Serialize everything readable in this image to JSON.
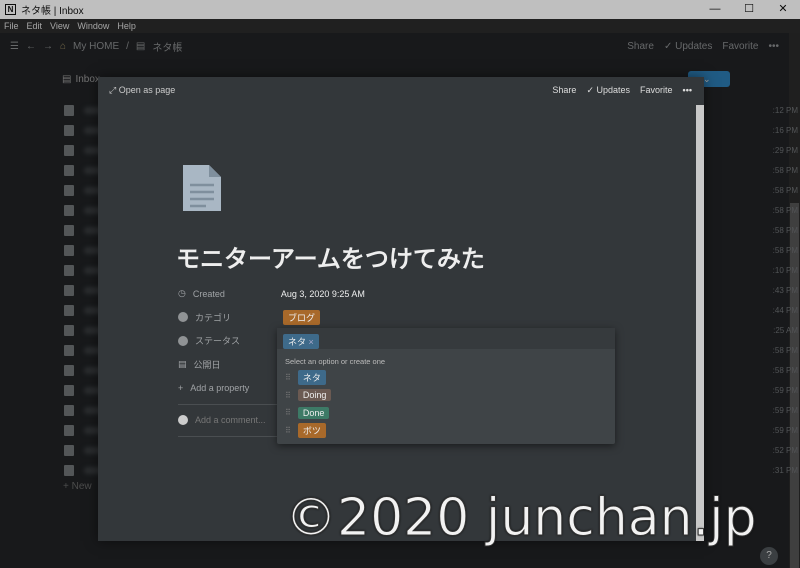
{
  "window": {
    "title": "ネタ帳 | Inbox",
    "logo": "N",
    "controls": [
      "—",
      "☐",
      "✕"
    ]
  },
  "menu": [
    "File",
    "Edit",
    "View",
    "Window",
    "Help"
  ],
  "nav": {
    "home": "My HOME",
    "sep": "/",
    "page": "ネタ帳",
    "share": "Share",
    "updates": "Updates",
    "favorite": "Favorite",
    "more": "•••"
  },
  "inbox": {
    "title": "Inbox",
    "new_btn": "w",
    "new_row": "New"
  },
  "rows": [
    {
      "icon": "doc",
      "time": ":12 PM"
    },
    {
      "icon": "doc",
      "time": ":16 PM"
    },
    {
      "icon": "doc",
      "time": ":29 PM"
    },
    {
      "icon": "doc",
      "time": ":58 PM"
    },
    {
      "icon": "doc",
      "time": ":58 PM"
    },
    {
      "icon": "doc",
      "time": ":58 PM"
    },
    {
      "icon": "doc",
      "time": ":58 PM"
    },
    {
      "icon": "doc",
      "time": ":58 PM"
    },
    {
      "icon": "doc",
      "time": ":10 PM"
    },
    {
      "icon": "doc",
      "time": ":43 PM"
    },
    {
      "icon": "doc",
      "time": ":44 PM"
    },
    {
      "icon": "doc",
      "time": ":25 AM"
    },
    {
      "icon": "mic",
      "time": ":58 PM"
    },
    {
      "icon": "mic",
      "time": ":58 PM"
    },
    {
      "icon": "mic",
      "time": ":59 PM"
    },
    {
      "icon": "mic",
      "time": ":59 PM"
    },
    {
      "icon": "mic",
      "time": ":59 PM"
    },
    {
      "icon": "mic",
      "time": ":52 PM"
    },
    {
      "icon": "mail",
      "time": ":31 PM"
    }
  ],
  "modal": {
    "open_as_page": "Open as page",
    "share": "Share",
    "updates": "Updates",
    "favorite": "Favorite",
    "more": "•••",
    "title": "モニターアームをつけてみた",
    "props": {
      "created_label": "Created",
      "created_value": "Aug 3, 2020 9:25 AM",
      "category_label": "カテゴリ",
      "category_value": "ブログ",
      "status_label": "ステータス",
      "date_label": "公開日",
      "add_property": "Add a property",
      "add_comment": "Add a comment..."
    }
  },
  "dropdown": {
    "selected": "ネタ",
    "remove": "×",
    "hint": "Select an option or create one",
    "options": [
      {
        "label": "ネタ",
        "color": "#3e6a8a"
      },
      {
        "label": "Doing",
        "color": "#6b5a52"
      },
      {
        "label": "Done",
        "color": "#3d7a66"
      },
      {
        "label": "ボツ",
        "color": "#a8692a"
      }
    ]
  },
  "colors": {
    "category_tag": "#a8692a",
    "accent": "#2b7ab0"
  },
  "watermark": "©2020 junchan.jp",
  "help": "?"
}
